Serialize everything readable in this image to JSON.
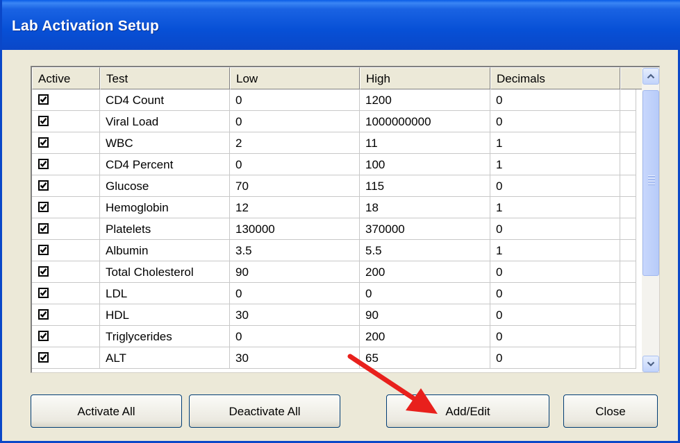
{
  "window": {
    "title": "Lab Activation Setup"
  },
  "grid": {
    "columns": [
      "Active",
      "Test",
      "Low",
      "High",
      "Decimals"
    ],
    "rows": [
      {
        "active": true,
        "test": "CD4 Count",
        "low": "0",
        "high": "1200",
        "decimals": "0"
      },
      {
        "active": true,
        "test": "Viral Load",
        "low": "0",
        "high": "1000000000",
        "decimals": "0"
      },
      {
        "active": true,
        "test": "WBC",
        "low": "2",
        "high": "11",
        "decimals": "1"
      },
      {
        "active": true,
        "test": "CD4 Percent",
        "low": "0",
        "high": "100",
        "decimals": "1"
      },
      {
        "active": true,
        "test": "Glucose",
        "low": "70",
        "high": "115",
        "decimals": "0"
      },
      {
        "active": true,
        "test": "Hemoglobin",
        "low": "12",
        "high": "18",
        "decimals": "1"
      },
      {
        "active": true,
        "test": "Platelets",
        "low": "130000",
        "high": "370000",
        "decimals": "0"
      },
      {
        "active": true,
        "test": "Albumin",
        "low": "3.5",
        "high": "5.5",
        "decimals": "1"
      },
      {
        "active": true,
        "test": "Total Cholesterol",
        "low": "90",
        "high": "200",
        "decimals": "0"
      },
      {
        "active": true,
        "test": "LDL",
        "low": "0",
        "high": "0",
        "decimals": "0"
      },
      {
        "active": true,
        "test": "HDL",
        "low": "30",
        "high": "90",
        "decimals": "0"
      },
      {
        "active": true,
        "test": "Triglycerides",
        "low": "0",
        "high": "200",
        "decimals": "0"
      },
      {
        "active": true,
        "test": "ALT",
        "low": "30",
        "high": "65",
        "decimals": "0"
      }
    ]
  },
  "buttons": {
    "activate_all": "Activate All",
    "deactivate_all": "Deactivate All",
    "add_edit": "Add/Edit",
    "close": "Close"
  },
  "colors": {
    "titlebar": "#0a47c8",
    "dialog_bg": "#ece9d8",
    "annotation_arrow": "#e8201c"
  }
}
